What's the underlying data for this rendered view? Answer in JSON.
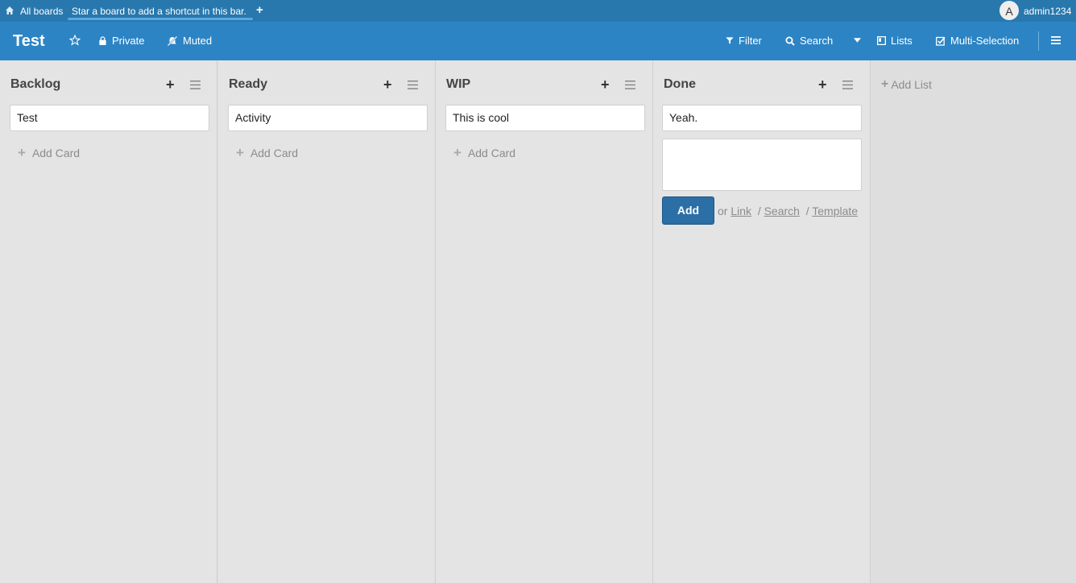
{
  "topbar": {
    "all_boards": "All boards",
    "hint": "Star a board to add a shortcut in this bar.",
    "add": "+",
    "avatar_initial": "A",
    "username": "admin1234"
  },
  "header": {
    "title": "Test",
    "private": "Private",
    "muted": "Muted",
    "filter": "Filter",
    "search": "Search",
    "lists": "Lists",
    "multi_selection": "Multi-Selection"
  },
  "lists": [
    {
      "title": "Backlog",
      "cards": [
        "Test"
      ],
      "add_card": "Add Card"
    },
    {
      "title": "Ready",
      "cards": [
        "Activity"
      ],
      "add_card": "Add Card"
    },
    {
      "title": "WIP",
      "cards": [
        "This is cool"
      ],
      "add_card": "Add Card"
    },
    {
      "title": "Done",
      "cards": [
        "Yeah."
      ]
    }
  ],
  "composer": {
    "add": "Add",
    "or": "or",
    "link": "Link",
    "search": "Search",
    "template": "Template",
    "sep": "/"
  },
  "add_list": "Add List",
  "colors": {
    "topbar": "#2878ae",
    "header": "#2c84c4",
    "add_button": "#2b6fa6"
  }
}
